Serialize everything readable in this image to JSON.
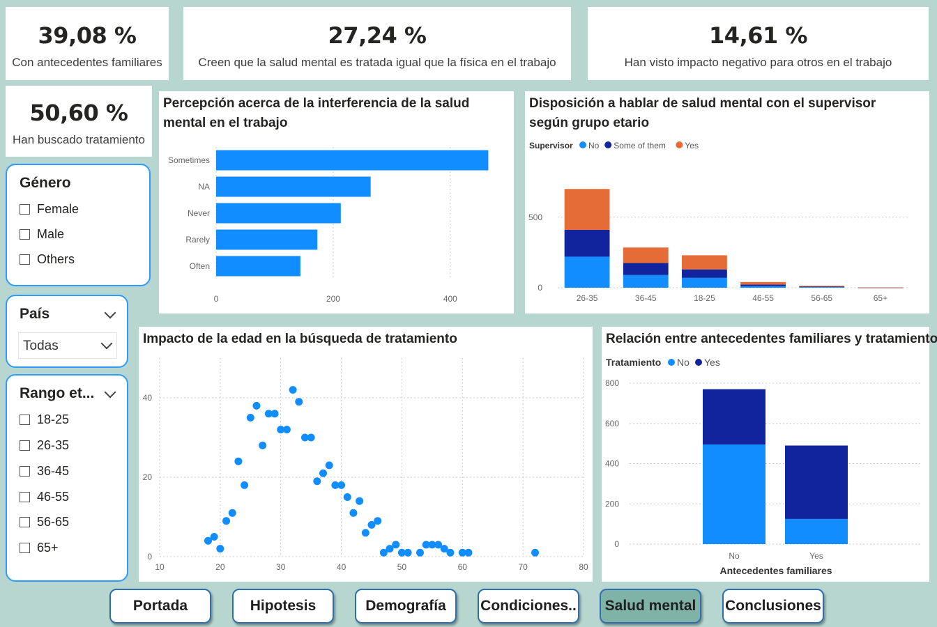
{
  "kpis": [
    {
      "value": "39,08 %",
      "label": "Con antecedentes familiares"
    },
    {
      "value": "27,24 %",
      "label": "Creen que la salud mental es tratada igual que la física en el trabajo"
    },
    {
      "value": "14,61 %",
      "label": "Han visto impacto negativo para otros en el trabajo"
    },
    {
      "value": "50,60 %",
      "label": "Han buscado tratamiento"
    }
  ],
  "slicers": {
    "genero": {
      "title": "Género",
      "items": [
        "Female",
        "Male",
        "Others"
      ]
    },
    "pais": {
      "title": "País",
      "selected": "Todas"
    },
    "rango": {
      "title": "Rango et...",
      "items": [
        "18-25",
        "26-35",
        "36-45",
        "46-55",
        "56-65",
        "65+"
      ]
    }
  },
  "charts": {
    "interferencia": {
      "title": "Percepción acerca de la interferencia de la salud mental en el trabajo"
    },
    "supervisor": {
      "title": "Disposición a hablar de salud mental con el supervisor según grupo etario",
      "legend_title": "Supervisor"
    },
    "edad": {
      "title": "Impacto de la edad en la búsqueda de tratamiento"
    },
    "antecedentes": {
      "title": "Relación entre antecedentes familiares y tratamiento",
      "legend_title": "Tratamiento",
      "xlabel": "Antecedentes familiares"
    }
  },
  "colors": {
    "light_blue": "#118dff",
    "dark_blue": "#12239e",
    "orange": "#e66c37"
  },
  "chart_data": [
    {
      "type": "bar",
      "orientation": "horizontal",
      "categories": [
        "Sometimes",
        "NA",
        "Never",
        "Rarely",
        "Often"
      ],
      "values": [
        465,
        264,
        213,
        173,
        144
      ],
      "xlim": [
        0,
        480
      ],
      "xticks": [
        0,
        200,
        400
      ],
      "grid": true
    },
    {
      "type": "bar",
      "stacked": true,
      "categories": [
        "26-35",
        "36-45",
        "18-25",
        "46-55",
        "56-65",
        "65+"
      ],
      "series": [
        {
          "name": "No",
          "color": "#118dff",
          "values": [
            220,
            90,
            70,
            12,
            5,
            1
          ]
        },
        {
          "name": "Some of them",
          "color": "#12239e",
          "values": [
            190,
            85,
            60,
            10,
            4,
            1
          ]
        },
        {
          "name": "Yes",
          "color": "#e66c37",
          "values": [
            290,
            110,
            100,
            18,
            5,
            1
          ]
        }
      ],
      "ylim": [
        0,
        800
      ],
      "yticks": [
        0,
        500
      ],
      "legend": "top-left",
      "grid": true
    },
    {
      "type": "scatter",
      "x": [
        18,
        19,
        20,
        21,
        22,
        23,
        24,
        25,
        26,
        27,
        28,
        29,
        30,
        31,
        32,
        33,
        34,
        35,
        36,
        37,
        38,
        39,
        40,
        41,
        42,
        43,
        44,
        45,
        46,
        47,
        48,
        49,
        50,
        51,
        53,
        54,
        55,
        56,
        57,
        58,
        60,
        61,
        72
      ],
      "y": [
        4,
        5,
        2,
        9,
        11,
        24,
        18,
        35,
        38,
        28,
        36,
        36,
        32,
        32,
        42,
        39,
        30,
        30,
        19,
        21,
        23,
        18,
        18,
        15,
        11,
        14,
        6,
        8,
        9,
        1,
        2,
        3,
        1,
        1,
        1,
        3,
        3,
        3,
        2,
        1,
        1,
        1,
        1
      ],
      "xlim": [
        10,
        80
      ],
      "ylim": [
        0,
        50
      ],
      "xticks": [
        10,
        20,
        30,
        40,
        50,
        60,
        70,
        80
      ],
      "yticks": [
        0,
        20,
        40
      ],
      "color": "#118dff",
      "grid": true
    },
    {
      "type": "bar",
      "stacked": true,
      "categories": [
        "No",
        "Yes"
      ],
      "series": [
        {
          "name": "No",
          "color": "#118dff",
          "values": [
            495,
            125
          ]
        },
        {
          "name": "Yes",
          "color": "#12239e",
          "values": [
            275,
            365
          ]
        }
      ],
      "ylim": [
        0,
        800
      ],
      "yticks": [
        0,
        200,
        400,
        600,
        800
      ],
      "xlabel": "Antecedentes familiares",
      "legend": "top-left",
      "grid": true
    }
  ],
  "nav": [
    "Portada",
    "Hipotesis",
    "Demografía",
    "Condiciones..",
    "Salud mental",
    "Conclusiones"
  ],
  "nav_active": 4
}
